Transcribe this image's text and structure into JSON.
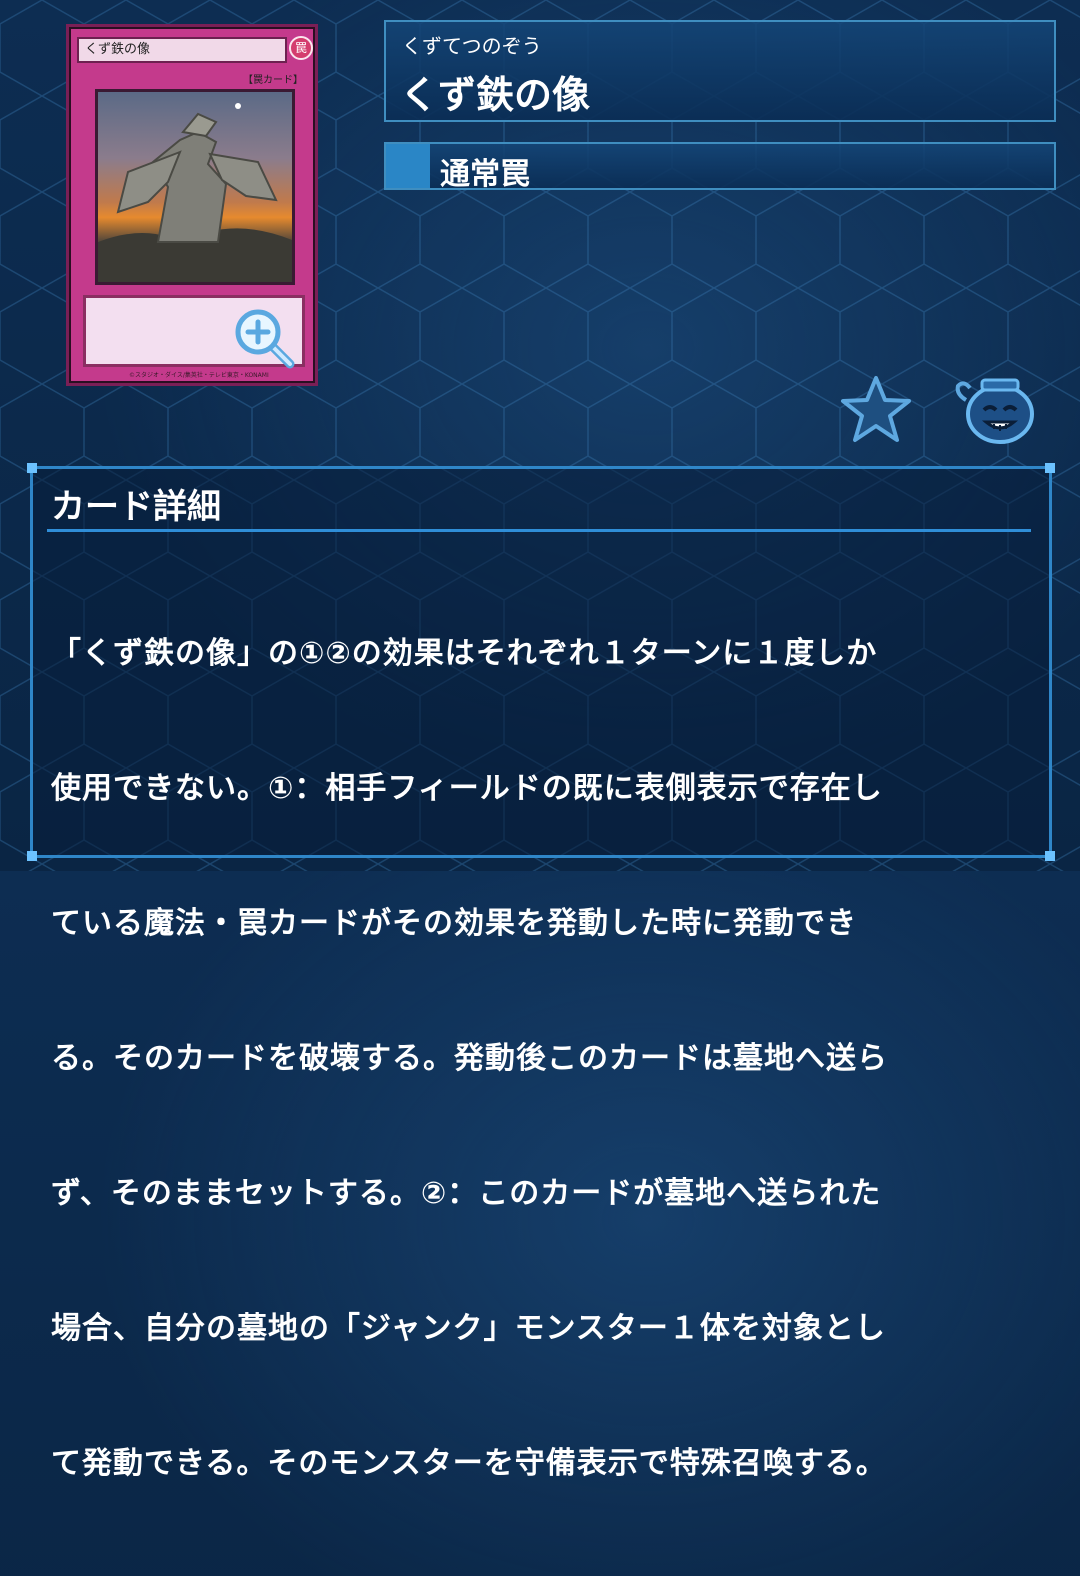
{
  "card_image": {
    "name": "くず鉄の像",
    "attribute_glyph": "罠",
    "type_tag": "【罠カード】",
    "copyright": "©スタジオ・ダイス/集英社・テレビ東京・KONAMI"
  },
  "name_panel": {
    "reading": "くずてつのぞう",
    "title": "くず鉄の像"
  },
  "type_panel": {
    "label": "通常罠"
  },
  "icons": {
    "zoom": "zoom-in-icon",
    "favorite": "star-icon",
    "mascot": "pot-of-greed-icon"
  },
  "detail": {
    "heading": "カード詳細",
    "lines": [
      "「くず鉄の像」の①②の効果はそれぞれ１ターンに１度しか",
      "使用できない。①：相手フィールドの既に表側表示で存在し",
      "ている魔法・罠カードがその効果を発動した時に発動でき",
      "る。そのカードを破壊する。発動後このカードは墓地へ送ら",
      "ず、そのままセットする。②：このカードが墓地へ送られた",
      "場合、自分の墓地の「ジャンク」モンスター１体を対象とし",
      "て発動できる。そのモンスターを守備表示で特殊召喚する。"
    ]
  },
  "colors": {
    "background": "#0c2a4a",
    "panel_border": "#3f8ec0",
    "accent": "#2a86c6",
    "card_frame": "#c43a8c",
    "text": "#ffffff"
  }
}
